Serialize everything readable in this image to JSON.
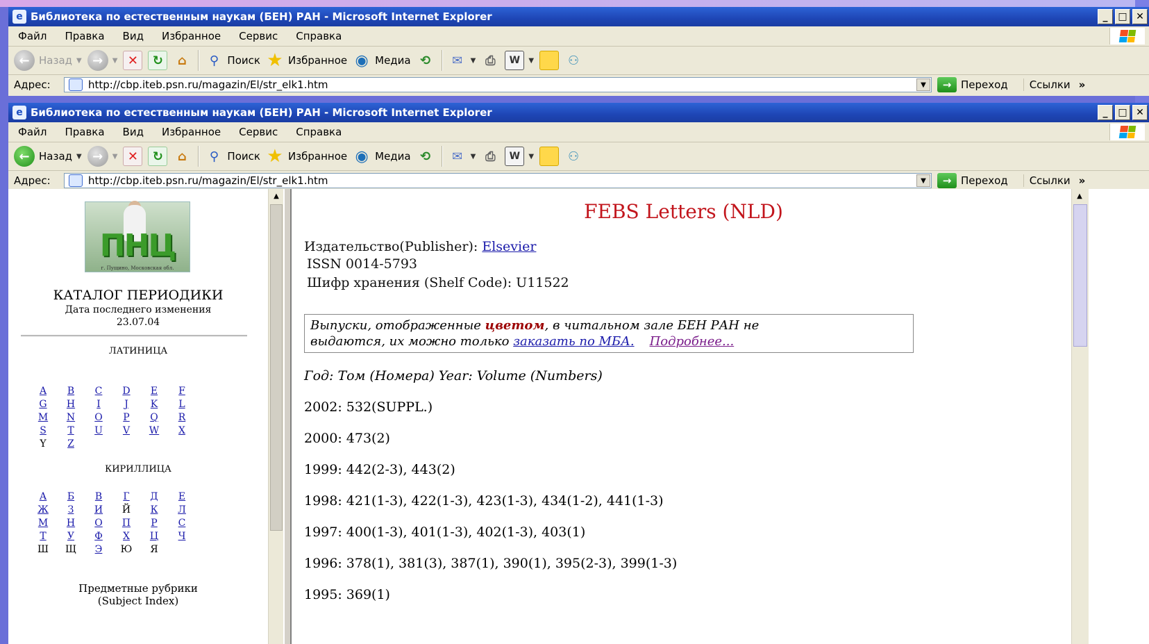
{
  "window": {
    "title": "Библиотека по естественным наукам (БЕН) РАН - Microsoft Internet Explorer",
    "controls": [
      "_",
      "□",
      "✕"
    ]
  },
  "menu": [
    "Файл",
    "Правка",
    "Вид",
    "Избранное",
    "Сервис",
    "Справка"
  ],
  "toolbar": {
    "back": "Назад",
    "search": "Поиск",
    "favorites": "Избранное",
    "media": "Медиа"
  },
  "address": {
    "label": "Адрес:",
    "url": "http://cbp.iteb.psn.ru/magazin/El/str_elk1.htm",
    "go": "Переход",
    "links": "Ссылки",
    "more": "»"
  },
  "left": {
    "logo_text": "ПНЦ",
    "logo_caption": "г. Пущино, Московская обл.",
    "catalog_title": "КАТАЛОГ ПЕРИОДИКИ",
    "date_label": "Дата последнего изменения",
    "date_value": "23.07.04",
    "latin_header": "ЛАТИНИЦА",
    "latin": [
      {
        "t": "A",
        "link": true
      },
      {
        "t": "B",
        "link": true
      },
      {
        "t": "C",
        "link": true
      },
      {
        "t": "D",
        "link": true
      },
      {
        "t": "E",
        "link": true
      },
      {
        "t": "F",
        "link": true
      },
      {
        "t": "G",
        "link": true
      },
      {
        "t": "H",
        "link": true
      },
      {
        "t": "I",
        "link": true
      },
      {
        "t": "J",
        "link": true
      },
      {
        "t": "K",
        "link": true
      },
      {
        "t": "L",
        "link": true
      },
      {
        "t": "M",
        "link": true
      },
      {
        "t": "N",
        "link": true
      },
      {
        "t": "O",
        "link": true
      },
      {
        "t": "P",
        "link": true
      },
      {
        "t": "Q",
        "link": true
      },
      {
        "t": "R",
        "link": true
      },
      {
        "t": "S",
        "link": true
      },
      {
        "t": "T",
        "link": true
      },
      {
        "t": "U",
        "link": true
      },
      {
        "t": "V",
        "link": true
      },
      {
        "t": "W",
        "link": true
      },
      {
        "t": "X",
        "link": true
      },
      {
        "t": "Y",
        "link": false
      },
      {
        "t": "Z",
        "link": true
      }
    ],
    "cyrillic_header": "КИРИЛЛИЦА",
    "cyrillic": [
      {
        "t": "А",
        "link": true
      },
      {
        "t": "Б",
        "link": true
      },
      {
        "t": "В",
        "link": true
      },
      {
        "t": "Г",
        "link": true
      },
      {
        "t": "Д",
        "link": true
      },
      {
        "t": "Е",
        "link": true
      },
      {
        "t": "Ж",
        "link": true
      },
      {
        "t": "З",
        "link": true
      },
      {
        "t": "И",
        "link": true
      },
      {
        "t": "Й",
        "link": false
      },
      {
        "t": "К",
        "link": true
      },
      {
        "t": "Л",
        "link": true
      },
      {
        "t": "М",
        "link": true
      },
      {
        "t": "Н",
        "link": true
      },
      {
        "t": "О",
        "link": true
      },
      {
        "t": "П",
        "link": true
      },
      {
        "t": "Р",
        "link": true
      },
      {
        "t": "С",
        "link": true
      },
      {
        "t": "Т",
        "link": true
      },
      {
        "t": "У",
        "link": true
      },
      {
        "t": "Ф",
        "link": true
      },
      {
        "t": "Х",
        "link": true
      },
      {
        "t": "Ц",
        "link": true
      },
      {
        "t": "Ч",
        "link": true
      },
      {
        "t": "Ш",
        "link": false
      },
      {
        "t": "Щ",
        "link": false
      },
      {
        "t": "Э",
        "link": true
      },
      {
        "t": "Ю",
        "link": false
      },
      {
        "t": "Я",
        "link": false
      }
    ],
    "subject_line1": "Предметные рубрики",
    "subject_line2": "(Subject Index)"
  },
  "main": {
    "journal_title": "FEBS Letters (NLD)",
    "publisher_label": "Издательство(Publisher):",
    "publisher": "Elsevier",
    "issn": "ISSN 0014-5793",
    "shelf": "Шифр хранения (Shelf Code): U11522",
    "notice_part1": "Выпуски, отображенные ",
    "notice_red": "цветом",
    "notice_part2": ", в читальном зале БЕН РАН не",
    "notice_part3": "выдаются, их можно только ",
    "notice_link": "заказать по МБА.",
    "notice_more": "Подробнее...",
    "year_header": "Год: Том (Номера) Year: Volume (Numbers)",
    "issues": [
      "2002: 532(SUPPL.)",
      "2000: 473(2)",
      "1999: 442(2-3), 443(2)",
      "1998: 421(1-3), 422(1-3), 423(1-3), 434(1-2), 441(1-3)",
      "1997: 400(1-3), 401(1-3), 402(1-3), 403(1)",
      "1996: 378(1), 381(3), 387(1), 390(1), 395(2-3), 399(1-3)",
      "1995: 369(1)"
    ]
  },
  "colors": {
    "title_bar": "#2d63d6",
    "journal_title": "#c2151c",
    "link": "#1a1aaa"
  }
}
